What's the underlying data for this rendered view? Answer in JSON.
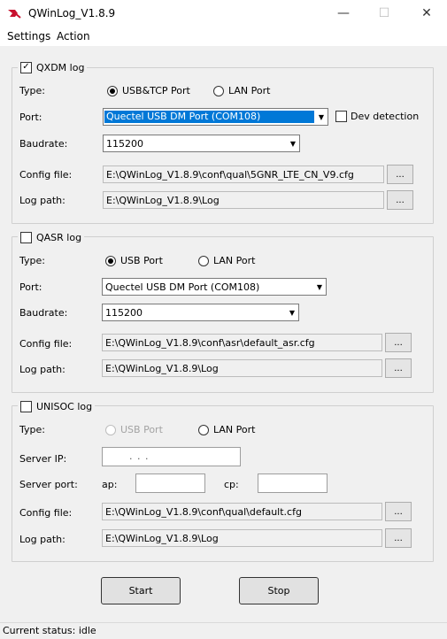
{
  "window": {
    "title": "QWinLog_V1.8.9",
    "minimize_icon": "minimize-icon",
    "maximize_icon": "maximize-icon",
    "close_icon": "close-icon"
  },
  "menu": {
    "settings": "Settings",
    "action": "Action"
  },
  "qxdm": {
    "title": "QXDM log",
    "enabled": true,
    "type_label": "Type:",
    "type_usb_tcp": "USB&TCP Port",
    "type_lan": "LAN Port",
    "type_selected": "usb_tcp",
    "port_label": "Port:",
    "port_value": "Quectel USB DM Port (COM108)",
    "dev_detection_label": "Dev detection",
    "dev_detection": false,
    "baud_label": "Baudrate:",
    "baud_value": "115200",
    "config_label": "Config file:",
    "config_value": "E:\\QWinLog_V1.8.9\\conf\\qual\\5GNR_LTE_CN_V9.cfg",
    "log_label": "Log path:",
    "log_value": "E:\\QWinLog_V1.8.9\\Log",
    "browse_label": "..."
  },
  "qasr": {
    "title": "QASR log",
    "enabled": false,
    "type_label": "Type:",
    "type_usb": "USB Port",
    "type_lan": "LAN Port",
    "type_selected": "usb",
    "port_label": "Port:",
    "port_value": "Quectel USB DM Port (COM108)",
    "baud_label": "Baudrate:",
    "baud_value": "115200",
    "config_label": "Config file:",
    "config_value": "E:\\QWinLog_V1.8.9\\conf\\asr\\default_asr.cfg",
    "log_label": "Log path:",
    "log_value": "E:\\QWinLog_V1.8.9\\Log",
    "browse_label": "..."
  },
  "unisoc": {
    "title": "UNISOC log",
    "enabled": false,
    "type_label": "Type:",
    "type_usb": "USB Port",
    "type_lan": "LAN Port",
    "type_selected": "none",
    "server_ip_label": "Server IP:",
    "server_ip_value": ".       .       .",
    "server_port_label": "Server port:",
    "ap_label": "ap:",
    "ap_value": "",
    "cp_label": "cp:",
    "cp_value": "",
    "config_label": "Config file:",
    "config_value": "E:\\QWinLog_V1.8.9\\conf\\qual\\default.cfg",
    "log_label": "Log path:",
    "log_value": "E:\\QWinLog_V1.8.9\\Log",
    "browse_label": "..."
  },
  "buttons": {
    "start": "Start",
    "stop": "Stop"
  },
  "status": {
    "text": "Current status: idle"
  },
  "colors": {
    "selection": "#0078d7",
    "logo": "#c8102e"
  }
}
